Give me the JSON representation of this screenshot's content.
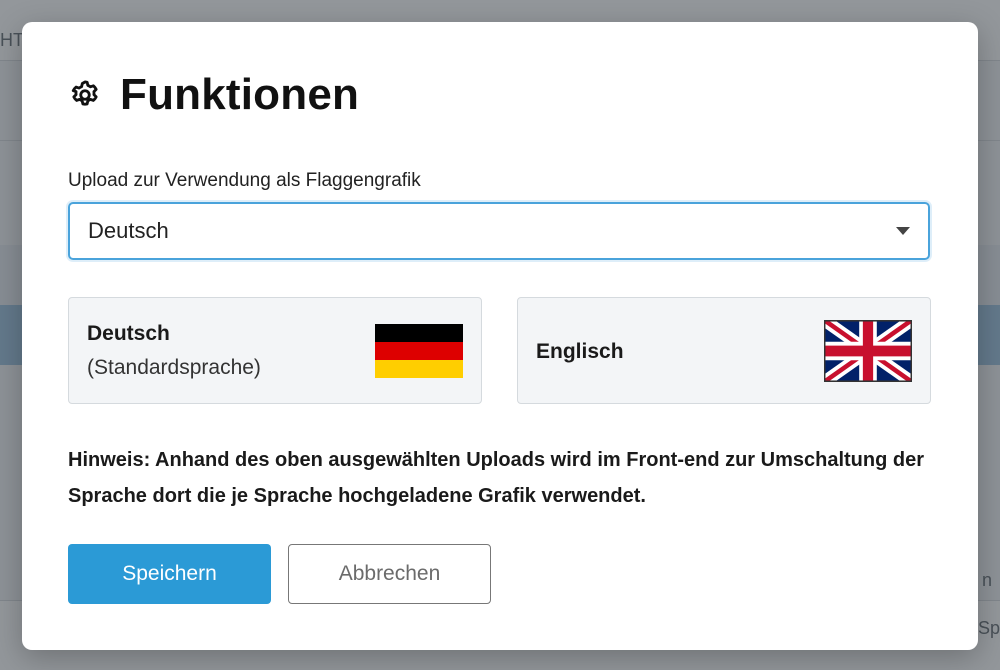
{
  "background": {
    "left_fragment": "HT",
    "right_fragment": "n",
    "right_fragment2": "-Sp"
  },
  "modal": {
    "title": "Funktionen",
    "title_icon": "gear-icon",
    "field_label": "Upload zur Verwendung als Flaggengrafik",
    "select": {
      "value": "Deutsch"
    },
    "languages": [
      {
        "name": "Deutsch",
        "subtitle": "(Standardsprache)",
        "flag": "german-flag-icon"
      },
      {
        "name": "Englisch",
        "subtitle": "",
        "flag": "uk-flag-icon"
      }
    ],
    "hint": "Hinweis: Anhand des oben ausgewählten Uploads wird im Front-end zur Umschaltung der Sprache dort die je Sprache hochgeladene Grafik verwendet.",
    "buttons": {
      "save": "Speichern",
      "cancel": "Abbrechen"
    }
  },
  "colors": {
    "accent": "#2b9ad6",
    "focus_border": "#4aa3db",
    "card_bg": "#f3f5f7"
  }
}
